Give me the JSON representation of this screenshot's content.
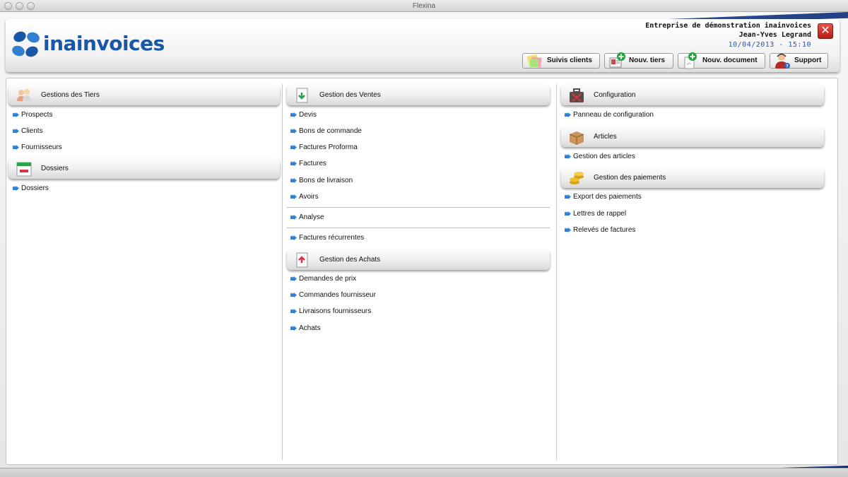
{
  "window": {
    "title": "Flexina"
  },
  "header": {
    "logo_text": "inainvoices",
    "company": "Entreprise de démonstration inainvoices",
    "user": "Jean-Yves Legrand",
    "datetime": "10/04/2013 - 15:10",
    "close_icon": "close-icon",
    "buttons": [
      {
        "label": "Suivis clients",
        "icon": "notes-icon"
      },
      {
        "label": "Nouv. tiers",
        "icon": "add-contact-icon"
      },
      {
        "label": "Nouv. document",
        "icon": "add-document-icon"
      },
      {
        "label": "Support",
        "icon": "support-agent-icon"
      }
    ]
  },
  "columns": {
    "left": {
      "sections": [
        {
          "title": "Gestions des Tiers",
          "icon": "people-icon",
          "items": [
            "Prospects",
            "Clients",
            "Fournisseurs"
          ]
        },
        {
          "title": "Dossiers",
          "icon": "calendar-icon",
          "items": [
            "Dossiers"
          ]
        }
      ]
    },
    "middle": {
      "sections": [
        {
          "title": "Gestion des Ventes",
          "icon": "sales-document-icon",
          "items": [
            "Devis",
            "Bons de commande",
            "Factures Proforma",
            "Factures",
            "Bons de livraison",
            "Avoirs"
          ],
          "extra": [
            "Analyse",
            "Factures récurrentes"
          ]
        },
        {
          "title": "Gestion des Achats",
          "icon": "purchase-document-icon",
          "items": [
            "Demandes de prix",
            "Commandes fournisseur",
            "Livraisons fournisseurs",
            "Achats"
          ]
        }
      ]
    },
    "right": {
      "sections": [
        {
          "title": "Configuration",
          "icon": "toolbox-icon",
          "items": [
            "Panneau de configuration"
          ]
        },
        {
          "title": "Articles",
          "icon": "box-icon",
          "items": [
            "Gestion des articles"
          ]
        },
        {
          "title": "Gestion des paiements",
          "icon": "coins-icon",
          "items": [
            "Export des paiements",
            "Lettres de rappel",
            "Relevés de factures"
          ]
        }
      ]
    }
  },
  "colors": {
    "brand": "#1a56a6",
    "accent_blue": "#2a54b5",
    "swoosh": "#0b2a78",
    "arrow": "#2f80d6"
  }
}
